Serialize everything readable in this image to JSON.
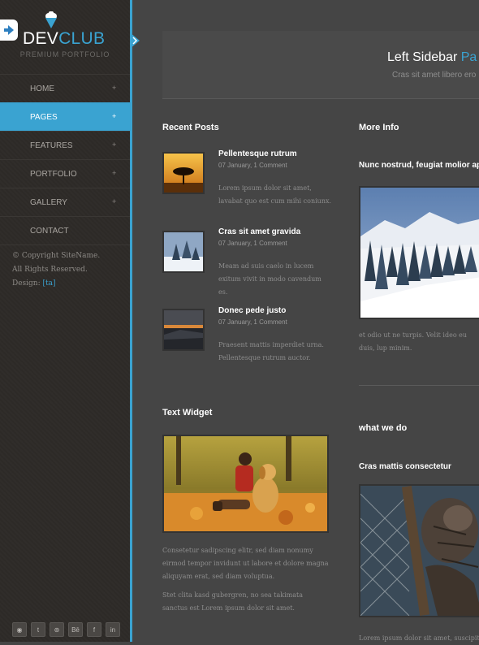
{
  "brand": {
    "name_part1": "DEV",
    "name_part2": "CLUB",
    "tagline": "PREMIUM PORTFOLIO"
  },
  "nav": {
    "items": [
      {
        "label": "HOME",
        "plus": "+"
      },
      {
        "label": "PAGES",
        "plus": "+",
        "active": true
      },
      {
        "label": "FEATURES",
        "plus": "+"
      },
      {
        "label": "PORTFOLIO",
        "plus": "+"
      },
      {
        "label": "GALLERY",
        "plus": "+"
      },
      {
        "label": "CONTACT"
      }
    ]
  },
  "footer": {
    "line1": "© Copyright SiteName.",
    "line2": "All Rights Reserved.",
    "design_label": "Design:",
    "design_link": "[ta]",
    "social": [
      "rss-icon",
      "twitter-icon",
      "dribbble-icon",
      "behance-icon",
      "facebook-icon",
      "linkedin-icon"
    ],
    "social_glyphs": [
      "◉",
      "t",
      "⊛",
      "Bē",
      "f",
      "in"
    ]
  },
  "header": {
    "title_part1": "Left Sidebar",
    "title_part2": "Pa",
    "subtitle": "Cras sit amet libero ero"
  },
  "recent_posts": {
    "heading": "Recent Posts",
    "posts": [
      {
        "title": "Pellentesque rutrum",
        "date": "07 January, 1 Comment",
        "text": "Lorem ipsum dolor sit amet, lavabat quo est cum mihi coniunx."
      },
      {
        "title": "Cras sit amet gravida",
        "date": "07 January, 1 Comment",
        "text": "Meam ad suis caelo in lucem exitum vivit in modo cavendum es."
      },
      {
        "title": "Donec pede justo",
        "date": "07 January, 1 Comment",
        "text": "Praesent mattis imperdiet urna. Pellentesque rutrum auctor."
      }
    ]
  },
  "more_info": {
    "heading": "More Info",
    "subheading": "Nunc nostrud, feugiat molior ap",
    "text": "et odio ut ne turpis. Velit ideo eu duis, lup minim."
  },
  "text_widget": {
    "heading": "Text Widget",
    "para1": "Consetetur sadipscing elitr, sed diam nonumy eirmod tempor invidunt ut labore et dolore magna aliquyam erat, sed diam voluptua.",
    "para2": "Stet clita kasd gubergren, no sea takimata sanctus est Lorem ipsum dolor sit amet."
  },
  "what_we_do": {
    "heading": "what we do",
    "subheading": "Cras mattis consectetur",
    "text": "Lorem ipsum dolor sit amet, suscipit teg"
  },
  "colors": {
    "accent": "#3aa3d1",
    "sidebar": "#2e2b28",
    "main": "#454545"
  }
}
